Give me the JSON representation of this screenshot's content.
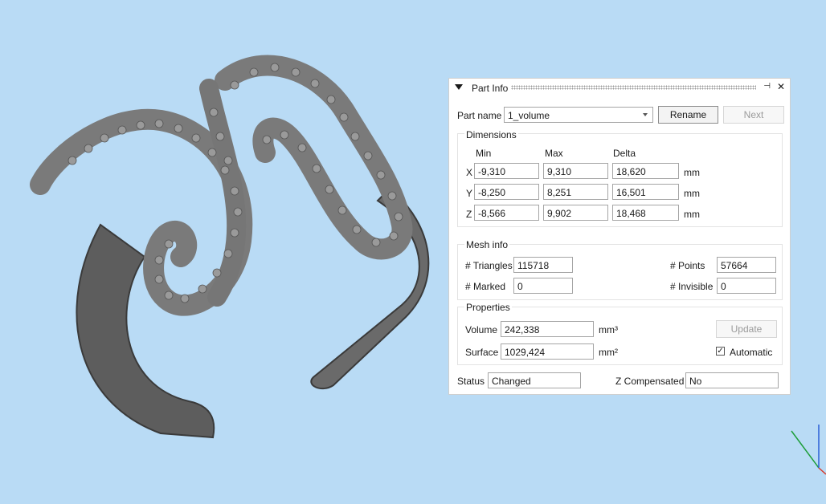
{
  "colors": {
    "viewport_bg": "#b9dbf5",
    "model": "#6b6b6b",
    "panel_bg": "#ffffff"
  },
  "panel": {
    "title": "Part Info",
    "pin_icon": "pin-icon",
    "close_symbol": "✕",
    "part_name_label": "Part name",
    "part_name_value": "1_volume",
    "rename_label": "Rename",
    "next_label": "Next",
    "dimensions": {
      "title": "Dimensions",
      "col_min": "Min",
      "col_max": "Max",
      "col_delta": "Delta",
      "unit": "mm",
      "rows": [
        {
          "axis": "X",
          "min": "-9,310",
          "max": "9,310",
          "delta": "18,620"
        },
        {
          "axis": "Y",
          "min": "-8,250",
          "max": "8,251",
          "delta": "16,501"
        },
        {
          "axis": "Z",
          "min": "-8,566",
          "max": "9,902",
          "delta": "18,468"
        }
      ]
    },
    "mesh": {
      "title": "Mesh info",
      "triangles_label": "# Triangles",
      "triangles": "115718",
      "points_label": "# Points",
      "points": "57664",
      "marked_label": "# Marked",
      "marked": "0",
      "invisible_label": "# Invisible",
      "invisible": "0"
    },
    "properties": {
      "title": "Properties",
      "volume_label": "Volume",
      "volume": "242,338",
      "volume_unit": "mm³",
      "surface_label": "Surface",
      "surface": "1029,424",
      "surface_unit": "mm²",
      "update_label": "Update",
      "automatic_label": "Automatic",
      "automatic_checked": "✓"
    },
    "status_label": "Status",
    "status": "Changed",
    "zcomp_label": "Z Compensated",
    "zcomp": "No"
  }
}
